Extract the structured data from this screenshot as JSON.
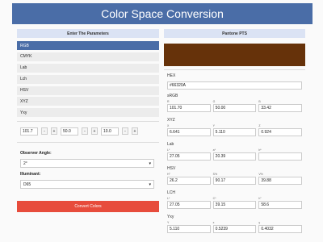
{
  "header": {
    "title": "Color Space Conversion"
  },
  "left_panel": {
    "title": "Enter The Parameters",
    "spaces": [
      {
        "label": "RGB",
        "active": true
      },
      {
        "label": "CMYK",
        "active": false
      },
      {
        "label": "Lab",
        "active": false
      },
      {
        "label": "Lch",
        "active": false
      },
      {
        "label": "HSV",
        "active": false
      },
      {
        "label": "XYZ",
        "active": false
      },
      {
        "label": "Yxy",
        "active": false
      }
    ],
    "inputs": {
      "v1": "101.7",
      "v2": "50.0",
      "v3": "10.0",
      "minus": "-",
      "plus": "+"
    },
    "observer": {
      "label": "Observer Angle:",
      "value": "2°"
    },
    "illuminant": {
      "label": "Illuminant:",
      "value": "D65"
    },
    "convert_label": "Convert Colors"
  },
  "right_panel": {
    "title": "Pantone PTS",
    "swatch_color": "#66320A",
    "hex": {
      "label": "HEX",
      "value": "#66320A"
    },
    "srgb": {
      "label": "sRGB",
      "sub": [
        "R",
        "G",
        "B"
      ],
      "values": [
        "101.70",
        "50.00",
        "33.42"
      ]
    },
    "xyz": {
      "label": "XYZ",
      "sub": [
        "X",
        "Y",
        "Z"
      ],
      "values": [
        "6.641",
        "5.110",
        "0.924"
      ]
    },
    "lab": {
      "label": "Lab",
      "sub": [
        "L*",
        "a*",
        "b*"
      ],
      "values": [
        "27.05",
        "20.39",
        ""
      ]
    },
    "hsv": {
      "label": "HSV",
      "sub": [
        "H°",
        "S%",
        "V%"
      ],
      "values": [
        "26.2",
        "90.17",
        "39.88"
      ]
    },
    "lch": {
      "label": "LCH",
      "sub": [
        "L*",
        "C*",
        "h°"
      ],
      "values": [
        "27.05",
        "39.15",
        "58.6"
      ]
    },
    "yxy": {
      "label": "Yxy",
      "sub": [
        "Y",
        "x",
        "y"
      ],
      "values": [
        "5.110",
        "0.5239",
        "0.4032"
      ]
    }
  }
}
